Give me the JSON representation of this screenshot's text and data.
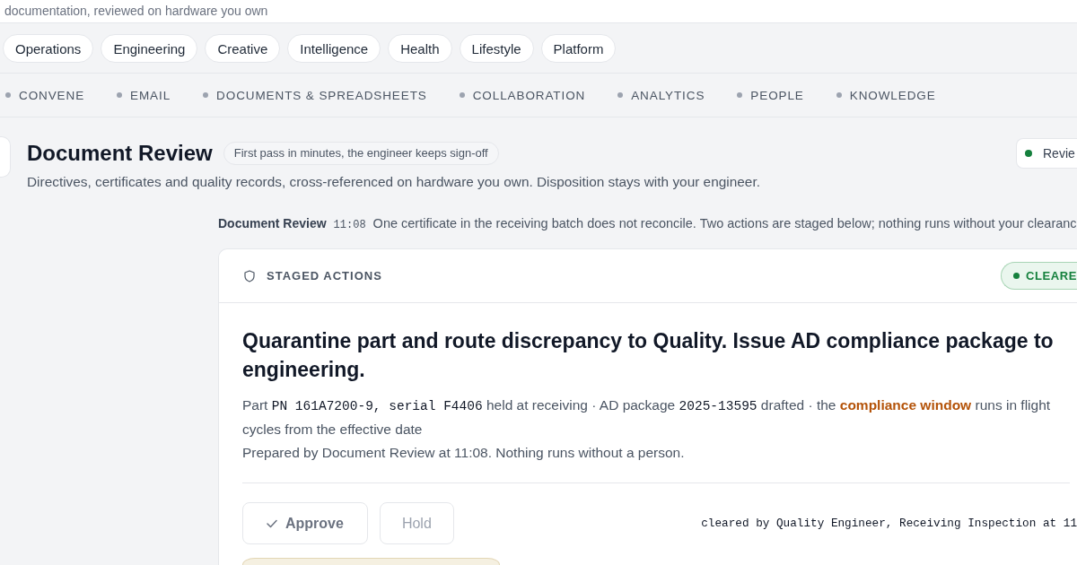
{
  "top_banner": {
    "text": "documentation, reviewed on hardware you own"
  },
  "tabs": [
    {
      "label": "Operations"
    },
    {
      "label": "Engineering"
    },
    {
      "label": "Creative"
    },
    {
      "label": "Intelligence"
    },
    {
      "label": "Health"
    },
    {
      "label": "Lifestyle"
    },
    {
      "label": "Platform"
    }
  ],
  "categories": [
    {
      "label": "CONVENE"
    },
    {
      "label": "EMAIL"
    },
    {
      "label": "DOCUMENTS & SPREADSHEETS"
    },
    {
      "label": "COLLABORATION"
    },
    {
      "label": "ANALYTICS"
    },
    {
      "label": "PEOPLE"
    },
    {
      "label": "KNOWLEDGE"
    }
  ],
  "header": {
    "title": "Document Review",
    "tagline": "First pass in minutes, the engineer keeps sign-off",
    "status_chip": "Revie",
    "description": "Directives, certificates and quality records, cross-referenced on hardware you own. Disposition stays with your engineer."
  },
  "status_line": {
    "agent": "Document Review",
    "time": "11:08",
    "message": "One certificate in the receiving batch does not reconcile. Two actions are staged below; nothing runs without your clearanc"
  },
  "card": {
    "title": "STAGED ACTIONS",
    "badge": "CLEARE",
    "heading": "Quarantine part and route discrepancy to Quality. Issue AD compliance package to engineering.",
    "detail": [
      {
        "kind": "text",
        "text": "Part "
      },
      {
        "kind": "code",
        "text": "PN 161A7200-9, serial F4406"
      },
      {
        "kind": "text",
        "text": " held at receiving · AD package "
      },
      {
        "kind": "code",
        "text": "2025-13595"
      },
      {
        "kind": "text",
        "text": " drafted · the "
      },
      {
        "kind": "link",
        "text": "compliance window"
      },
      {
        "kind": "text",
        "text": " runs in flight cycles from the effective date"
      }
    ],
    "prepared": "Prepared by Document Review at 11:08. Nothing runs without a person.",
    "actions": [
      {
        "kind": "approve",
        "label": "Approve"
      },
      {
        "kind": "hold",
        "label": "Hold"
      }
    ],
    "audit": "cleared by Quality Engineer, Receiving Inspection at 11"
  }
}
